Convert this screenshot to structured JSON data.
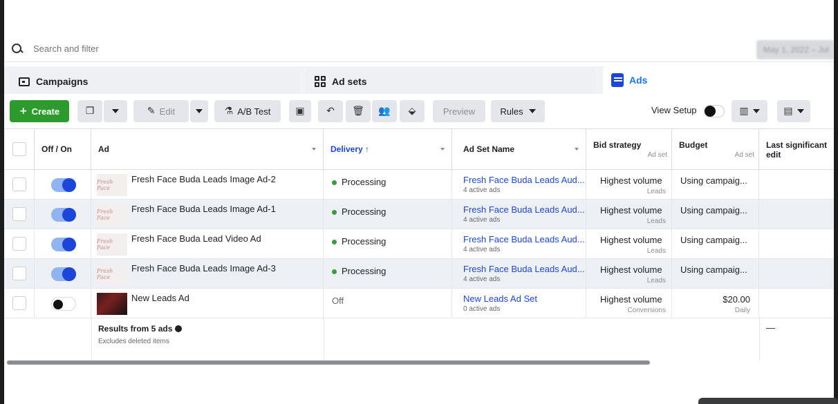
{
  "search": {
    "placeholder": "Search and filter",
    "date_range": "May 1, 2022 – Jul"
  },
  "tabs": [
    {
      "label": "Campaigns",
      "icon": "folder-icon"
    },
    {
      "label": "Ad sets",
      "icon": "grid-icon"
    },
    {
      "label": "Ads",
      "icon": "ads-icon",
      "active": true
    }
  ],
  "toolbar": {
    "create": "Create",
    "edit": "Edit",
    "ab_test": "A/B Test",
    "preview": "Preview",
    "rules": "Rules",
    "view_setup": "View Setup"
  },
  "columns": {
    "off_on": "Off / On",
    "ad": "Ad",
    "delivery": "Delivery ↑",
    "ad_set_name": "Ad Set Name",
    "bid_strategy": "Bid strategy",
    "bid_strategy_sub": "Ad set",
    "budget": "Budget",
    "budget_sub": "Ad set",
    "last_edit": "Last significant edit"
  },
  "rows": [
    {
      "on": true,
      "thumb": "Fresh Face",
      "ad": "Fresh Face Buda Leads Image Ad-2",
      "delivery": "Processing",
      "ad_set": "Fresh Face Buda Leads Aud...",
      "ad_set_sub": "4 active ads",
      "bid": "Highest volume",
      "bid_sub": "Leads",
      "budget": "Using campaig..."
    },
    {
      "on": true,
      "thumb": "Fresh Face",
      "ad": "Fresh Face Buda Leads Image Ad-1",
      "delivery": "Processing",
      "ad_set": "Fresh Face Buda Leads Aud...",
      "ad_set_sub": "4 active ads",
      "bid": "Highest volume",
      "bid_sub": "Leads",
      "budget": "Using campaig..."
    },
    {
      "on": true,
      "thumb": "Fresh Face",
      "ad": "Fresh Face Buda Lead Video Ad",
      "delivery": "Processing",
      "ad_set": "Fresh Face Buda Leads Aud...",
      "ad_set_sub": "4 active ads",
      "bid": "Highest volume",
      "bid_sub": "Leads",
      "budget": "Using campaig..."
    },
    {
      "on": true,
      "thumb": "Fresh Face",
      "ad": "Fresh Face Buda Leads Image Ad-3",
      "delivery": "Processing",
      "ad_set": "Fresh Face Buda Leads Aud...",
      "ad_set_sub": "4 active ads",
      "bid": "Highest volume",
      "bid_sub": "Leads",
      "budget": "Using campaig..."
    },
    {
      "on": false,
      "thumb": "",
      "ad": "New Leads Ad",
      "delivery": "Off",
      "ad_set": "New Leads Ad Set",
      "ad_set_sub": "0 active ads",
      "bid": "Highest volume",
      "bid_sub": "Conversions",
      "budget": "$20.00",
      "budget_sub": "Daily"
    }
  ],
  "summary": {
    "title": "Results from 5 ads",
    "sub": "Excludes deleted items",
    "last_edit": "—"
  },
  "colors": {
    "create_green": "#2d9a2d",
    "active_blue": "#1b46d9",
    "link_blue": "#1b46d9",
    "status_green": "#3a9b3a"
  }
}
